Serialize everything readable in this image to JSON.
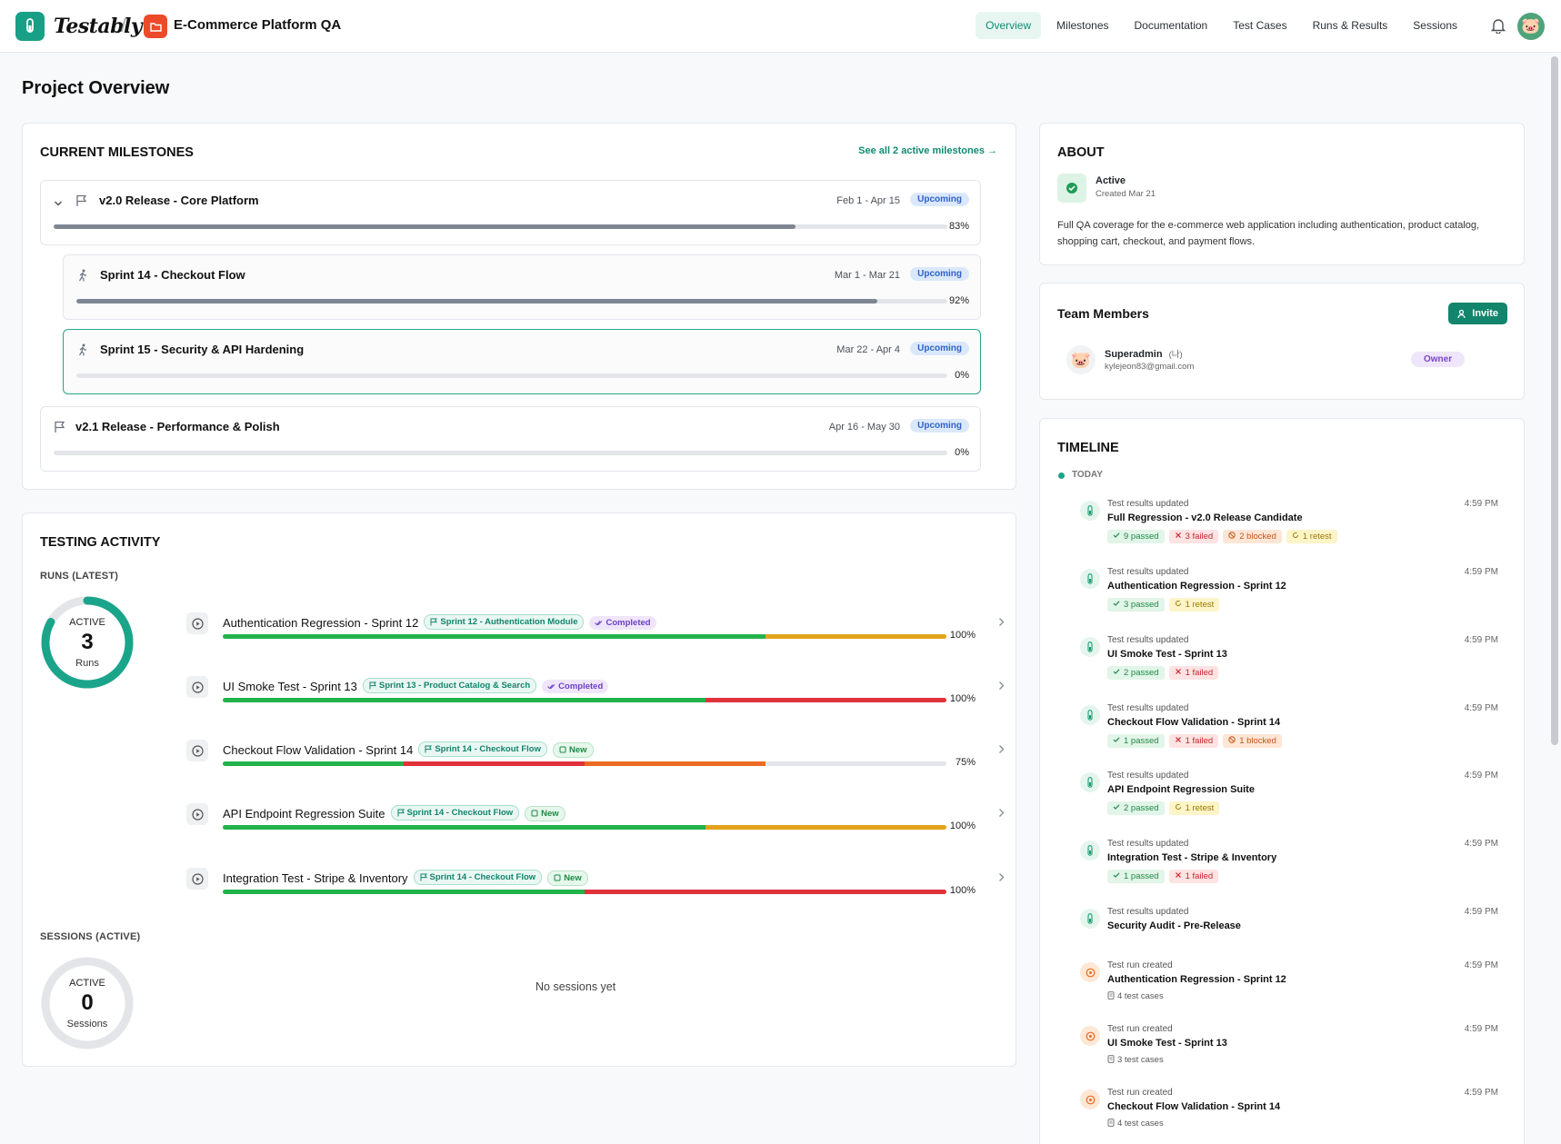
{
  "brand": {
    "logo_text": "Testably",
    "separator": "/",
    "project_name": "E-Commerce Platform QA"
  },
  "nav": {
    "items": [
      "Overview",
      "Milestones",
      "Documentation",
      "Test Cases",
      "Runs & Results",
      "Sessions"
    ],
    "active": "Overview"
  },
  "page": {
    "title": "Project Overview"
  },
  "milestones": {
    "title": "CURRENT MILESTONES",
    "see_all": "See all 2 active milestones →",
    "items": [
      {
        "name": "v2.0 Release - Core Platform",
        "dates": "Feb 1 - Apr 15",
        "status": "Upcoming",
        "progress": 83,
        "pct": "83%"
      },
      {
        "name": "Sprint 14 - Checkout Flow",
        "dates": "Mar 1 - Mar 21",
        "status": "Upcoming",
        "progress": 92,
        "pct": "92%"
      },
      {
        "name": "Sprint 15 - Security & API Hardening",
        "dates": "Mar 22 - Apr 4",
        "status": "Upcoming",
        "progress": 0,
        "pct": "0%"
      },
      {
        "name": "v2.1 Release - Performance & Polish",
        "dates": "Apr 16 - May 30",
        "status": "Upcoming",
        "progress": 0,
        "pct": "0%"
      }
    ]
  },
  "activity": {
    "title": "TESTING ACTIVITY",
    "runs_label": "RUNS (LATEST)",
    "runs_donut": {
      "top": "ACTIVE",
      "value": "3",
      "bottom": "Runs",
      "fraction": 0.83
    },
    "runs": [
      {
        "name": "Authentication Regression - Sprint 12",
        "sprint": "Sprint 12 - Authentication Module",
        "status": "Completed",
        "pct": "100%",
        "segments": [
          [
            "g",
            75
          ],
          [
            "y",
            25
          ]
        ]
      },
      {
        "name": "UI Smoke Test - Sprint 13",
        "sprint": "Sprint 13 - Product Catalog & Search",
        "status": "Completed",
        "pct": "100%",
        "segments": [
          [
            "g",
            66.7
          ],
          [
            "r",
            33.3
          ]
        ]
      },
      {
        "name": "Checkout Flow Validation - Sprint 14",
        "sprint": "Sprint 14 - Checkout Flow",
        "status": "New",
        "pct": "75%",
        "segments": [
          [
            "g",
            25
          ],
          [
            "r",
            25
          ],
          [
            "o",
            25
          ],
          [
            "e",
            25
          ]
        ]
      },
      {
        "name": "API Endpoint Regression Suite",
        "sprint": "Sprint 14 - Checkout Flow",
        "status": "New",
        "pct": "100%",
        "segments": [
          [
            "g",
            66.7
          ],
          [
            "y",
            33.3
          ]
        ]
      },
      {
        "name": "Integration Test - Stripe & Inventory",
        "sprint": "Sprint 14 - Checkout Flow",
        "status": "New",
        "pct": "100%",
        "segments": [
          [
            "g",
            50
          ],
          [
            "r",
            50
          ]
        ]
      }
    ],
    "sessions_label": "SESSIONS (ACTIVE)",
    "sessions_donut": {
      "top": "ACTIVE",
      "value": "0",
      "bottom": "Sessions"
    },
    "sessions_empty": "No sessions yet"
  },
  "about": {
    "title": "ABOUT",
    "status": "Active",
    "created": "Created Mar 21",
    "description": "Full QA coverage for the e-commerce web application including authentication, product catalog, shopping cart, checkout, and payment flows."
  },
  "team": {
    "title": "Team Members",
    "invite": "Invite",
    "members": [
      {
        "name": "Superadmin",
        "tag": "(나)",
        "email": "kylejeon83@gmail.com",
        "role": "Owner"
      }
    ]
  },
  "timeline": {
    "title": "TIMELINE",
    "today": "TODAY",
    "items": [
      {
        "kind": "Test results updated",
        "title": "Full Regression - v2.0 Release Candidate",
        "time": "4:59 PM",
        "chips": [
          [
            "pass",
            "9 passed"
          ],
          [
            "fail",
            "3 failed"
          ],
          [
            "block",
            "2 blocked"
          ],
          [
            "retest",
            "1 retest"
          ]
        ]
      },
      {
        "kind": "Test results updated",
        "title": "Authentication Regression - Sprint 12",
        "time": "4:59 PM",
        "chips": [
          [
            "pass",
            "3 passed"
          ],
          [
            "retest",
            "1 retest"
          ]
        ]
      },
      {
        "kind": "Test results updated",
        "title": "UI Smoke Test - Sprint 13",
        "time": "4:59 PM",
        "chips": [
          [
            "pass",
            "2 passed"
          ],
          [
            "fail",
            "1 failed"
          ]
        ]
      },
      {
        "kind": "Test results updated",
        "title": "Checkout Flow Validation - Sprint 14",
        "time": "4:59 PM",
        "chips": [
          [
            "pass",
            "1 passed"
          ],
          [
            "fail",
            "1 failed"
          ],
          [
            "block",
            "1 blocked"
          ]
        ]
      },
      {
        "kind": "Test results updated",
        "title": "API Endpoint Regression Suite",
        "time": "4:59 PM",
        "chips": [
          [
            "pass",
            "2 passed"
          ],
          [
            "retest",
            "1 retest"
          ]
        ]
      },
      {
        "kind": "Test results updated",
        "title": "Integration Test - Stripe & Inventory",
        "time": "4:59 PM",
        "chips": [
          [
            "pass",
            "1 passed"
          ],
          [
            "fail",
            "1 failed"
          ]
        ]
      },
      {
        "kind": "Test results updated",
        "title": "Security Audit - Pre-Release",
        "time": "4:59 PM",
        "chips": []
      },
      {
        "kind": "Test run created",
        "title": "Authentication Regression - Sprint 12",
        "time": "4:59 PM",
        "sub": "4 test cases"
      },
      {
        "kind": "Test run created",
        "title": "UI Smoke Test - Sprint 13",
        "time": "4:59 PM",
        "sub": "3 test cases"
      },
      {
        "kind": "Test run created",
        "title": "Checkout Flow Validation - Sprint 14",
        "time": "4:59 PM",
        "sub": "4 test cases"
      }
    ]
  },
  "colors": {
    "brand": "#17a085",
    "project": "#ec4a2a",
    "passed": "#22b24c",
    "failed": "#e0323a",
    "blocked": "#ec6b22",
    "retest": "#e3a31b"
  }
}
